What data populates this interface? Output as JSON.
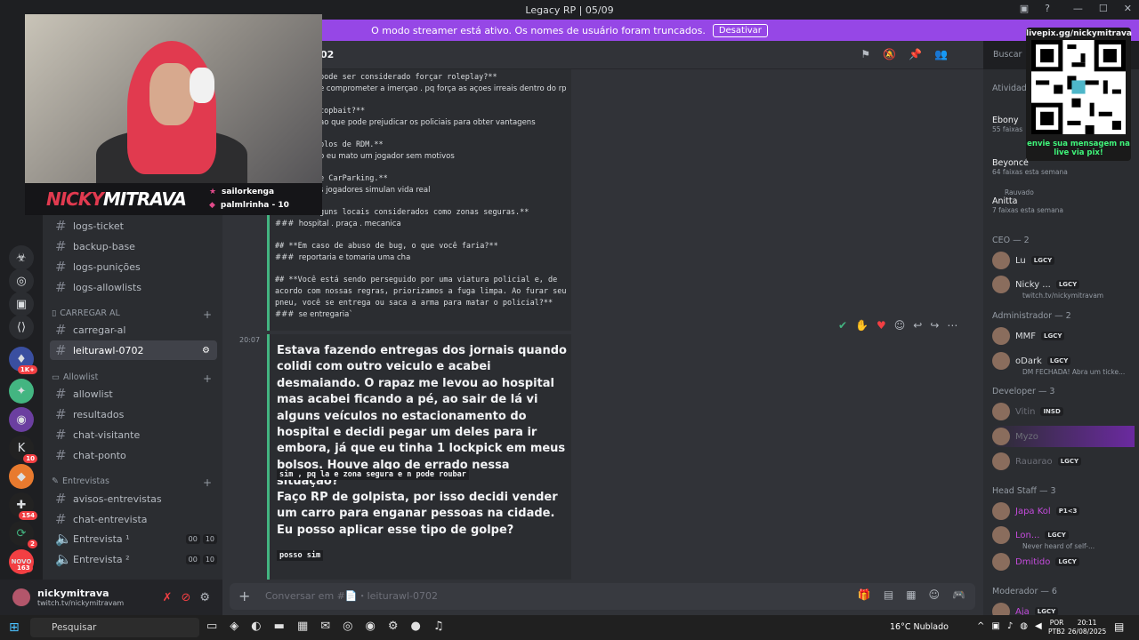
{
  "window": {
    "title": "Legacy RP | 05/09"
  },
  "banner": {
    "text": "O modo streamer está ativo. Os nomes de usuário foram truncados.",
    "button": "Desativar"
  },
  "rail": {
    "badges": [
      "1K+",
      "10",
      "154",
      "2",
      "163"
    ],
    "new_label": "NOVO"
  },
  "channels": {
    "items": [
      {
        "name": "logs-ticket"
      },
      {
        "name": "backup-base"
      },
      {
        "name": "logs-punições"
      },
      {
        "name": "logs-allowlists"
      }
    ],
    "cat_carregar": "CARREGAR AL",
    "carregar_items": [
      "carregar-al",
      "leiturawl-0702"
    ],
    "cat_allowlist": "Allowlist",
    "allowlist_items": [
      "allowlist",
      "resultados",
      "chat-visitante",
      "chat-ponto"
    ],
    "cat_entrevistas": "Entrevistas",
    "entrevista_items": [
      "avisos-entrevistas",
      "chat-entrevista"
    ],
    "voice": [
      {
        "name": "Entrevista ¹",
        "a": "00",
        "b": "10"
      },
      {
        "name": "Entrevista ²",
        "a": "00",
        "b": "10"
      }
    ]
  },
  "user": {
    "name": "nickymitrava",
    "sub": "twitch.tv/nickymitravam"
  },
  "header": {
    "channel": "02",
    "search": "Buscar"
  },
  "quiz": [
    {
      "t": "pode ser considerado forçar roleplay?**",
      "ans": false
    },
    {
      "t": "e comprometer a imerçao . pq força as açoes irreais dentro do rp",
      "ans": true
    },
    {
      "t": "copbait?**",
      "ans": false
    },
    {
      "t": "ao que pode prejudicar os policiais para obter vantagens",
      "ans": true
    },
    {
      "t": "plos de RDM.**",
      "ans": false
    },
    {
      "t": "o eu mato um jogador sem motivos",
      "ans": true
    },
    {
      "t": "e CarParking.**",
      "ans": false
    },
    {
      "t": "s jogadores simulan vida real",
      "ans": true
    },
    {
      "t": "guns locais considerados como zonas seguras.**",
      "ans": false
    },
    {
      "t": "###  hospital . praça . mecanica",
      "ans": true
    },
    {
      "t": "## **Em caso de abuso de bug, o que você faria?**",
      "ans": false
    },
    {
      "t": "###  reportaria e tomaria uma cha",
      "ans": true
    },
    {
      "t": "## **Você está sendo perseguido por uma viatura policial e, de",
      "ans": false
    },
    {
      "t": "acordo com nossas regras, priorizamos a fuga limpa. Ao furar seu",
      "ans": false
    },
    {
      "t": "pneu, você se entrega ou saca a arma para matar o policial?**",
      "ans": false
    },
    {
      "t": "###  se entregaria`",
      "ans": true
    }
  ],
  "message": {
    "time": "20:07",
    "q1": "Estava fazendo entregas dos jornais quando colidi com outro veiculo e acabei desmaiando. O rapaz me levou ao hospital mas acabei ficando a pé, ao sair de lá vi alguns veículos no estacionamento do hospital e decidi pegar um deles para ir embora, já que eu tinha 1 lockpick em meus bolsos. Houve algo de errado nessa situação?",
    "a1": "sim , pq la e zona segura e n pode roubar",
    "q2": "Faço RP de golpista, por isso decidi vender um carro para enganar pessoas na cidade. Eu posso aplicar esse tipo de golpe?",
    "a2": "posso sim"
  },
  "input": {
    "placeholder": "Conversar em #📄・leiturawl-0702"
  },
  "activity": {
    "title": "Atividade",
    "items": [
      {
        "name": "Ebony",
        "sub": "55 faixas"
      },
      {
        "name": "Beyoncé",
        "sub": "64 faixas esta semana"
      },
      {
        "name": "Anitta",
        "sub": "7 faixas esta semana",
        "who": "Rauvado"
      }
    ]
  },
  "members": {
    "ceo_head": "CEO — 2",
    "ceo": [
      {
        "name": "Lu",
        "tag": "LGCY",
        "sub": ""
      },
      {
        "name": "Nicky ...",
        "tag": "LGCY",
        "sub": "twitch.tv/nickymitravam"
      }
    ],
    "adm_head": "Administrador — 2",
    "adm": [
      {
        "name": "MMF",
        "tag": "LGCY",
        "sub": ""
      },
      {
        "name": "oDark",
        "tag": "LGCY",
        "sub": "DM FECHADA! Abra um ticke..."
      }
    ],
    "dev_head": "Developer — 3",
    "dev": [
      {
        "name": "Vitin",
        "tag": "INSD"
      },
      {
        "name": "Myzo",
        "tag": ""
      },
      {
        "name": "Rauarao",
        "tag": "LGCY"
      }
    ],
    "hs_head": "Head Staff — 3",
    "hs": [
      {
        "name": "Japa Kol",
        "tag": "P1<3",
        "sub": ""
      },
      {
        "name": "Lon...",
        "tag": "LGCY",
        "sub": "Never heard of self-..."
      },
      {
        "name": "Dmitido",
        "tag": "LGCY",
        "sub": ""
      }
    ],
    "mod_head": "Moderador — 6",
    "mod": [
      {
        "name": "Aja",
        "tag": "LGCY"
      }
    ]
  },
  "overlay": {
    "logo_a": "NICKY",
    "logo_b": "MITRAVA",
    "sub1": "sailorkenga",
    "sub2": "palmlrinha - 10",
    "qr_top": "livepix.gg/nickymitrava",
    "qr_bot": "envie sua mensagem na live via pix!"
  },
  "taskbar": {
    "search": "Pesquisar",
    "weather": "16°C  Nublado",
    "lang1": "POR",
    "lang2": "PTB2",
    "time": "20:11",
    "date": "26/08/2025"
  }
}
